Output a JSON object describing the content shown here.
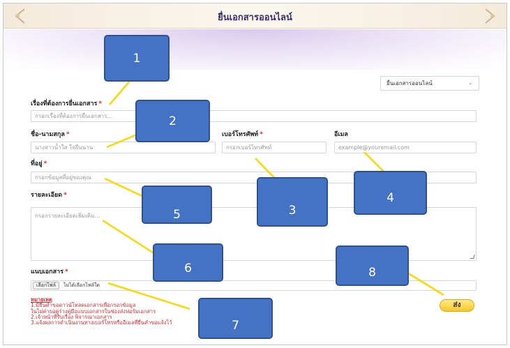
{
  "header": {
    "title": "ยื่นเอกสารออนไลน์"
  },
  "select": {
    "value": "ยื่นเอกสารออนไลน์"
  },
  "form": {
    "subject": {
      "label": "เรื่องที่ต้องการยื่นเอกสาร",
      "placeholder": "กรอกเรื่องที่ต้องการยื่นเอกสาร..."
    },
    "name": {
      "label": "ชื่อ-นามสกุล",
      "placeholder": "นางสาวน้ำใส ใจยืนนาน"
    },
    "phone": {
      "label": "เบอร์โทรศัพท์",
      "placeholder": "กรอกเบอร์โทรศัพท์"
    },
    "email": {
      "label": "อีเมล",
      "placeholder": "example@youremail.com"
    },
    "address": {
      "label": "ที่อยู่",
      "placeholder": "กรอกข้อมูลที่อยู่ของคุณ"
    },
    "details": {
      "label": "รายละเอียด",
      "placeholder": "กรอกรายละเอียดเพิ่มเติม..."
    },
    "attachment": {
      "label": "แนบเอกสาร",
      "button": "เลือกไฟล์",
      "status": "ไม่ได้เลือกไฟล์ใด"
    },
    "required_mark": "*"
  },
  "note": {
    "title": "หมายเหตุ",
    "lines": [
      "1.มียื่นคำขอดาวน์โหลดเอกสารเพื่อกรอกข้อมูล",
      "ในไม่ค่ายอดูร่างคู่มือแบบเอกสารในช่องส่งฟอร์มเอกสาร",
      "2.เจ้าหน้าที่รับเรื่อง พิจารณาเอกสาร",
      "3.แจ้งผลการดำเนินงานทางเบอร์โทรหรืออีเมลที่ยื่นคำขอแจ้งไว้"
    ]
  },
  "send_label": "ส่ง",
  "callouts": [
    "1",
    "2",
    "3",
    "4",
    "5",
    "6",
    "7",
    "8"
  ],
  "colors": {
    "callout": "#4472c4",
    "callout_line": "#ffd700",
    "required": "#e0262b",
    "send": "#f7c928"
  }
}
